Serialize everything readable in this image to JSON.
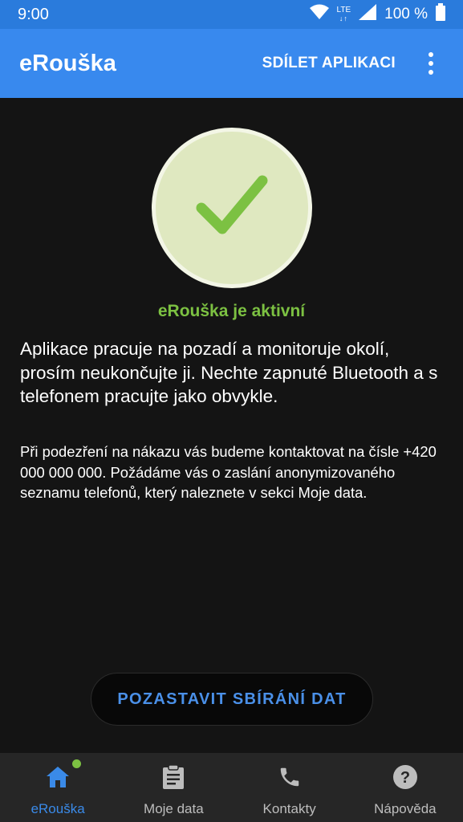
{
  "status_bar": {
    "time": "9:00",
    "network": "LTE",
    "battery": "100 %",
    "icons": [
      "wifi-icon",
      "lte-icon",
      "signal-icon",
      "battery-icon"
    ]
  },
  "app_bar": {
    "title": "eRouška",
    "share_label": "SDÍLET APLIKACI",
    "menu_icon": "more-vert-icon"
  },
  "status": {
    "icon": "check-icon",
    "label": "eRouška je aktivní",
    "color": "#7cc142"
  },
  "main_text": "Aplikace pracuje na pozadí a monitoruje okolí, prosím neukončujte ji. Nechte zapnuté Bluetooth a s telefonem pracujte jako obvykle.",
  "sub_text": "Při podezření na nákazu vás budeme kontaktovat na čísle +420 000  000 000. Požádáme vás o zaslání anonymizovaného seznamu telefonů, který naleznete v sekci Moje data.",
  "pause_button": "POZASTAVIT SBÍRÁNÍ DAT",
  "bottom_nav": [
    {
      "label": "eRouška",
      "icon": "home-icon",
      "active": true
    },
    {
      "label": "Moje data",
      "icon": "clipboard-icon",
      "active": false
    },
    {
      "label": "Kontakty",
      "icon": "phone-icon",
      "active": false
    },
    {
      "label": "Nápověda",
      "icon": "help-icon",
      "active": false
    }
  ],
  "colors": {
    "accent": "#3889ee",
    "status_bar": "#2a7bdc",
    "success": "#7cc142",
    "background": "#141414"
  }
}
